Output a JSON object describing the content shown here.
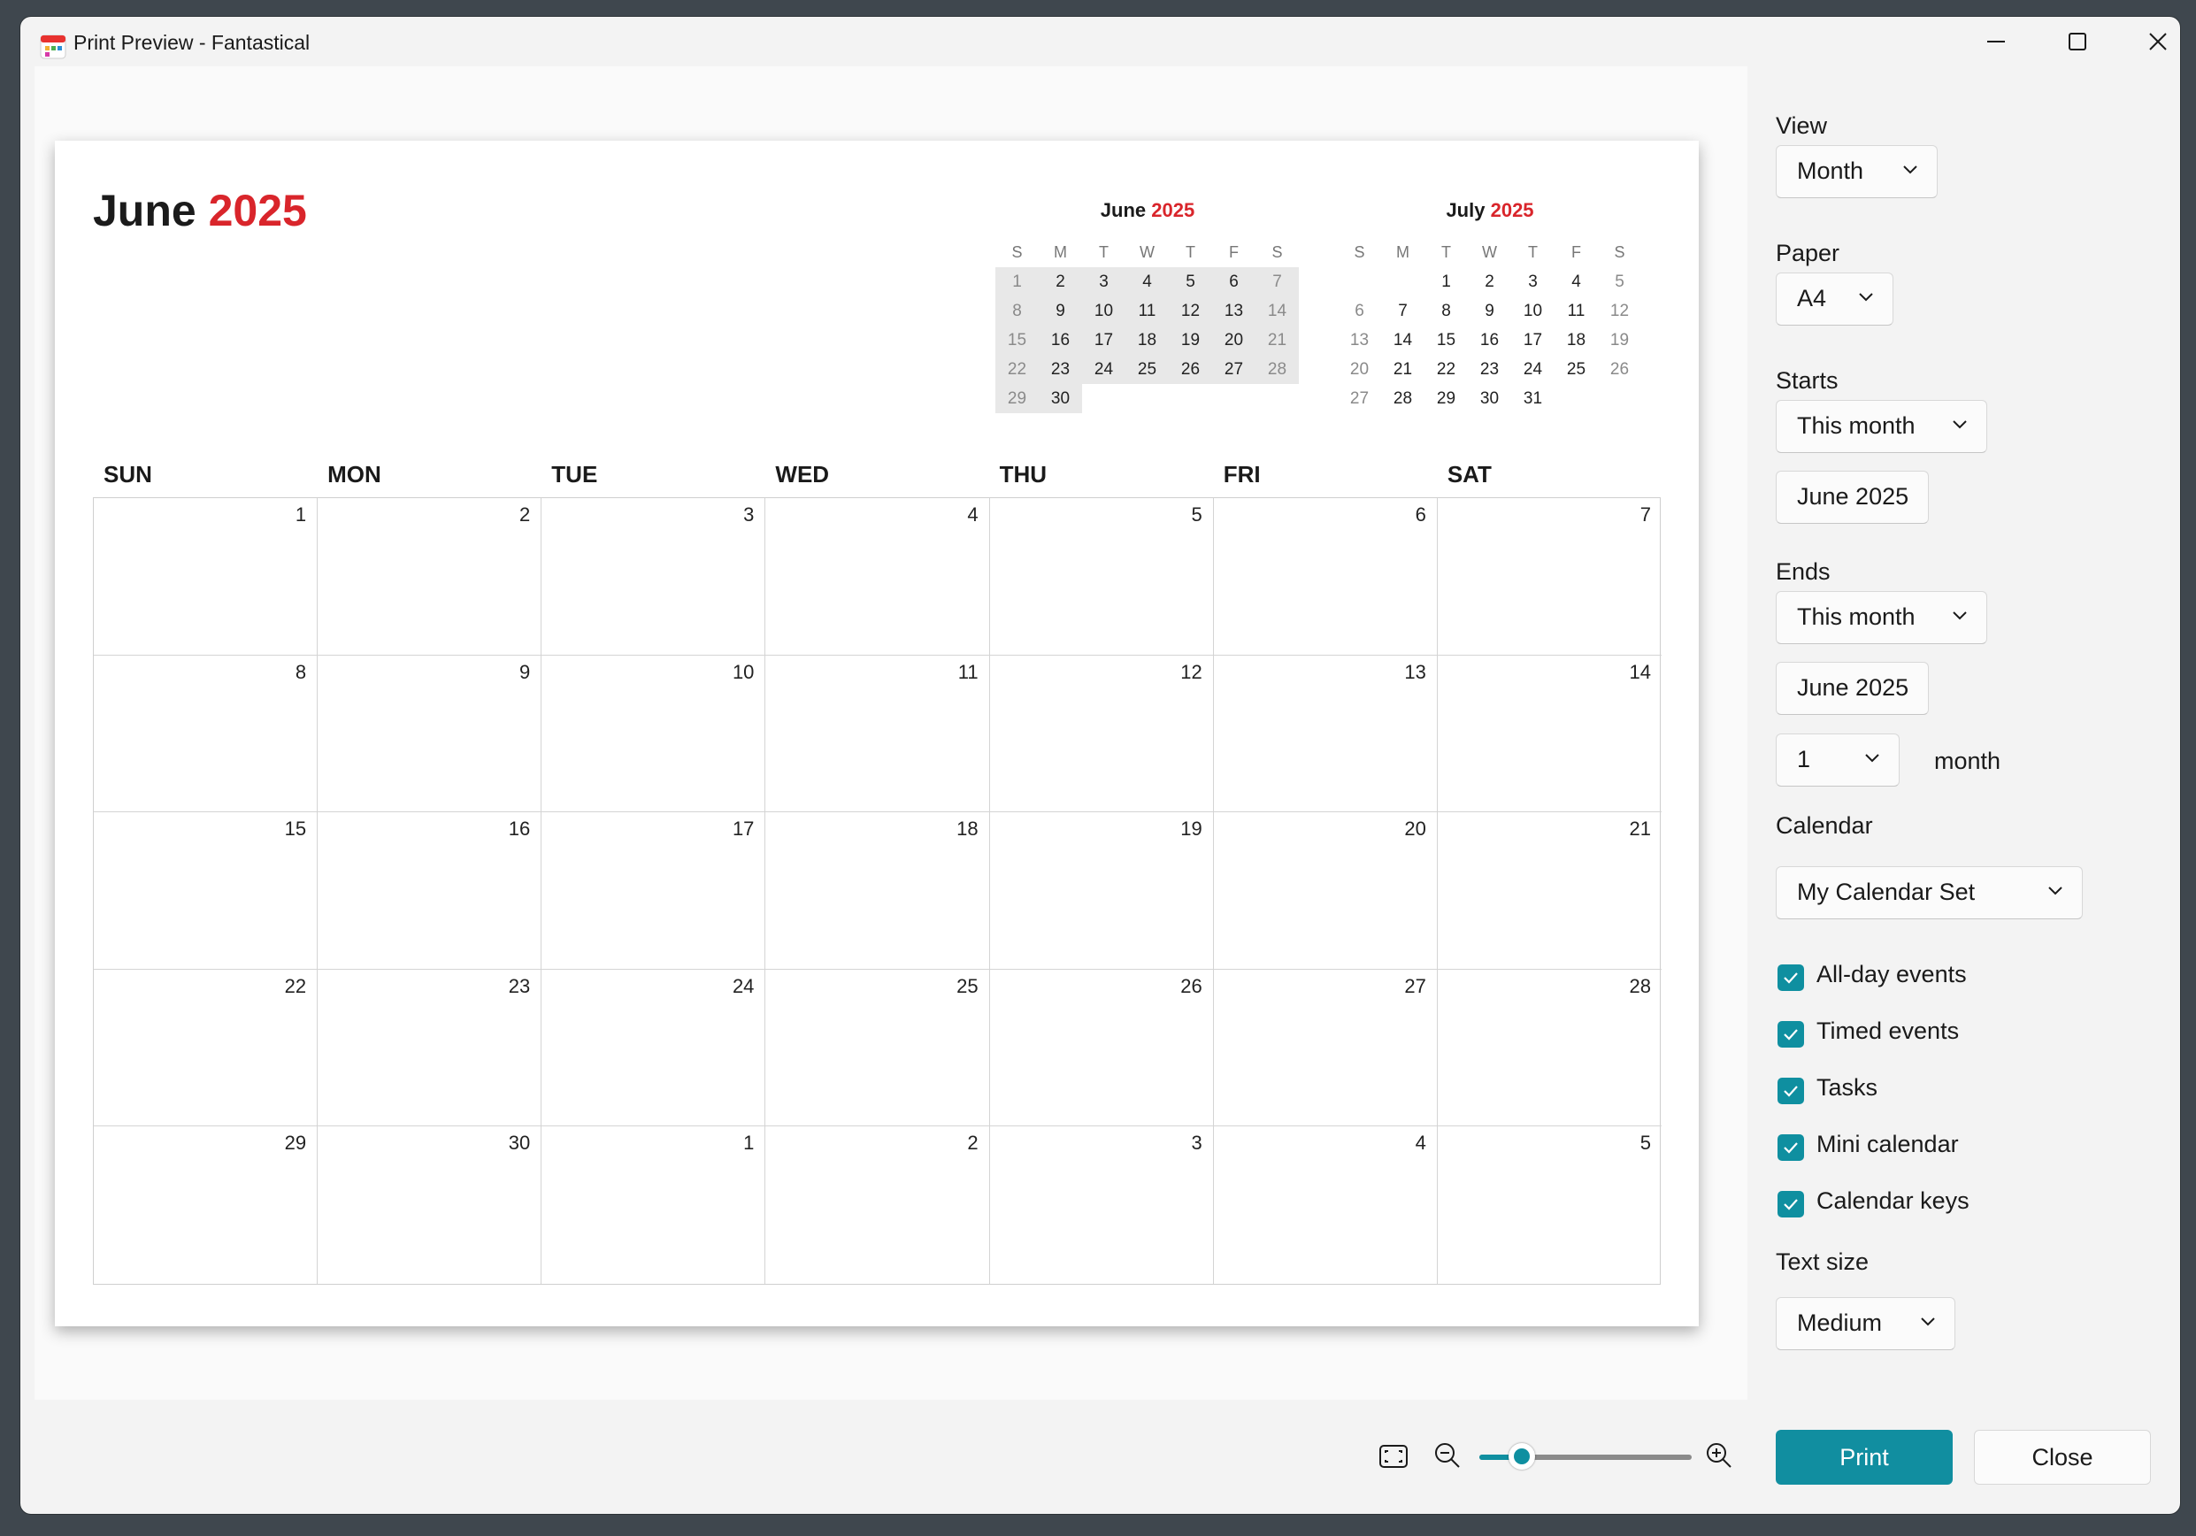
{
  "window": {
    "title": "Print Preview - Fantastical",
    "accent": "#118ea0",
    "year_color": "#d9252b"
  },
  "page": {
    "month": "June",
    "year": "2025",
    "mini_calendars": [
      {
        "month": "June",
        "year": "2025",
        "headers": [
          "S",
          "M",
          "T",
          "W",
          "T",
          "F",
          "S"
        ],
        "rows": [
          [
            "1",
            "2",
            "3",
            "4",
            "5",
            "6",
            "7"
          ],
          [
            "8",
            "9",
            "10",
            "11",
            "12",
            "13",
            "14"
          ],
          [
            "15",
            "16",
            "17",
            "18",
            "19",
            "20",
            "21"
          ],
          [
            "22",
            "23",
            "24",
            "25",
            "26",
            "27",
            "28"
          ],
          [
            "29",
            "30",
            "",
            "",
            "",
            "",
            ""
          ]
        ]
      },
      {
        "month": "July",
        "year": "2025",
        "headers": [
          "S",
          "M",
          "T",
          "W",
          "T",
          "F",
          "S"
        ],
        "rows": [
          [
            "",
            "",
            "1",
            "2",
            "3",
            "4",
            "5"
          ],
          [
            "6",
            "7",
            "8",
            "9",
            "10",
            "11",
            "12"
          ],
          [
            "13",
            "14",
            "15",
            "16",
            "17",
            "18",
            "19"
          ],
          [
            "20",
            "21",
            "22",
            "23",
            "24",
            "25",
            "26"
          ],
          [
            "27",
            "28",
            "29",
            "30",
            "31",
            "",
            ""
          ]
        ]
      }
    ],
    "day_names": [
      "SUN",
      "MON",
      "TUE",
      "WED",
      "THU",
      "FRI",
      "SAT"
    ],
    "weeks": [
      [
        "1",
        "2",
        "3",
        "4",
        "5",
        "6",
        "7"
      ],
      [
        "8",
        "9",
        "10",
        "11",
        "12",
        "13",
        "14"
      ],
      [
        "15",
        "16",
        "17",
        "18",
        "19",
        "20",
        "21"
      ],
      [
        "22",
        "23",
        "24",
        "25",
        "26",
        "27",
        "28"
      ],
      [
        "29",
        "30",
        "1",
        "2",
        "3",
        "4",
        "5"
      ]
    ]
  },
  "sidebar": {
    "view": {
      "label": "View",
      "value": "Month"
    },
    "paper": {
      "label": "Paper",
      "value": "A4"
    },
    "starts": {
      "label": "Starts",
      "value": "This month",
      "date": "June 2025"
    },
    "ends": {
      "label": "Ends",
      "value": "This month",
      "date": "June 2025",
      "count": "1",
      "unit": "month"
    },
    "calendar": {
      "label": "Calendar",
      "value": "My Calendar Set"
    },
    "options": [
      {
        "label": "All-day events",
        "checked": true
      },
      {
        "label": "Timed events",
        "checked": true
      },
      {
        "label": "Tasks",
        "checked": true
      },
      {
        "label": "Mini calendar",
        "checked": true
      },
      {
        "label": "Calendar keys",
        "checked": true
      }
    ],
    "text_size": {
      "label": "Text size",
      "value": "Medium"
    }
  },
  "footer": {
    "print_label": "Print",
    "close_label": "Close",
    "zoom_level": 0.2
  }
}
